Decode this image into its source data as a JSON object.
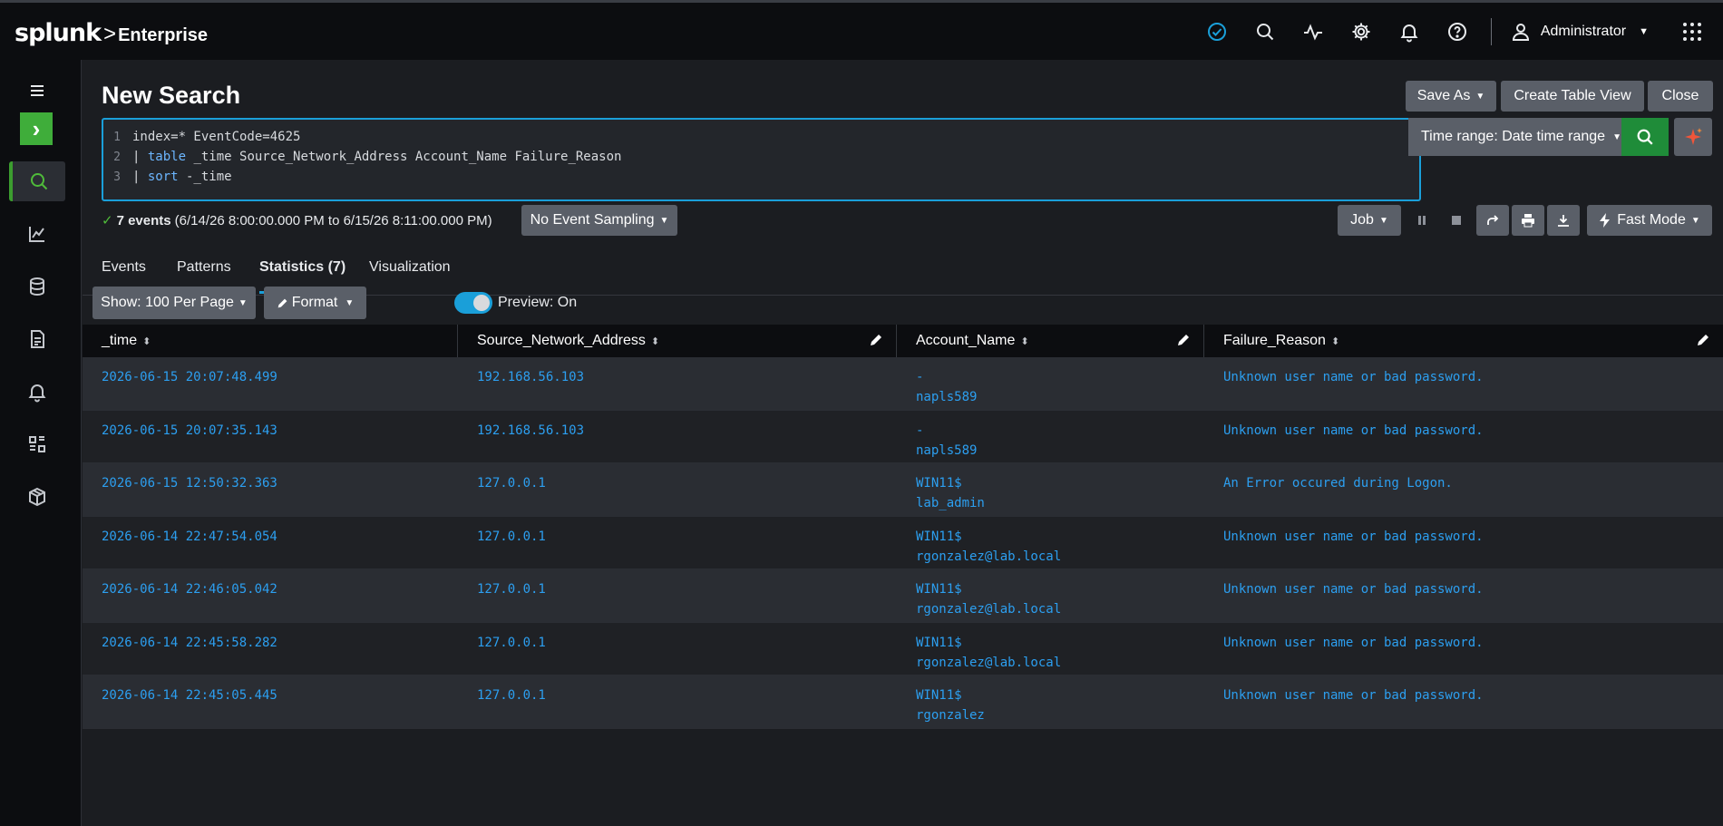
{
  "brand": {
    "logo": "splunk",
    "separator": ">",
    "product": "Enterprise"
  },
  "topbar": {
    "user_name": "Administrator"
  },
  "icons": [
    "status-check-icon",
    "search-icon",
    "activity-icon",
    "gear-icon",
    "bell-icon",
    "help-icon",
    "user-icon",
    "apps-grid-icon",
    "menu-icon",
    "search-nav-icon",
    "chart-icon",
    "database-icon",
    "report-icon",
    "alert-bell-icon",
    "dashboards-icon",
    "datasets-icon",
    "pencil-icon",
    "lightning-icon",
    "sparkle-icon"
  ],
  "page": {
    "title": "New Search"
  },
  "header_buttons": {
    "save_as": "Save As",
    "create_table_view": "Create Table View",
    "close": "Close"
  },
  "search": {
    "lines": [
      {
        "n": "1",
        "text": "index=* EventCode=4625"
      },
      {
        "n": "2",
        "pipe": "| ",
        "cmd": "table",
        "rest": " _time Source_Network_Address Account_Name Failure_Reason"
      },
      {
        "n": "3",
        "pipe": "| ",
        "cmd": "sort",
        "rest": " -_time"
      }
    ],
    "time_range": "Time range: Date time range"
  },
  "status": {
    "count": "7 events",
    "range": "(6/14/26 8:00:00.000 PM to 6/15/26 8:11:00.000 PM)",
    "sampling": "No Event Sampling",
    "job": "Job",
    "mode": "Fast Mode"
  },
  "tabs": [
    {
      "label": "Events"
    },
    {
      "label": "Patterns"
    },
    {
      "label": "Statistics (7)"
    },
    {
      "label": "Visualization"
    }
  ],
  "toolbar": {
    "show": "Show: 100 Per Page",
    "format": "Format",
    "preview": "Preview: On"
  },
  "colors": {
    "accent": "#1a9fd9",
    "go_green": "#1f8c39",
    "link": "#2c9ff0"
  },
  "table": {
    "columns": [
      "_time",
      "Source_Network_Address",
      "Account_Name",
      "Failure_Reason"
    ],
    "rows": [
      {
        "time": "2026-06-15 20:07:48.499",
        "src": "192.168.56.103",
        "acct1": "-",
        "acct2": "napls589",
        "reason": "Unknown user name or bad password."
      },
      {
        "time": "2026-06-15 20:07:35.143",
        "src": "192.168.56.103",
        "acct1": "-",
        "acct2": "napls589",
        "reason": "Unknown user name or bad password."
      },
      {
        "time": "2026-06-15 12:50:32.363",
        "src": "127.0.0.1",
        "acct1": "WIN11$",
        "acct2": "lab_admin",
        "reason": "An Error occured during Logon."
      },
      {
        "time": "2026-06-14 22:47:54.054",
        "src": "127.0.0.1",
        "acct1": "WIN11$",
        "acct2": "rgonzalez@lab.local",
        "reason": "Unknown user name or bad password."
      },
      {
        "time": "2026-06-14 22:46:05.042",
        "src": "127.0.0.1",
        "acct1": "WIN11$",
        "acct2": "rgonzalez@lab.local",
        "reason": "Unknown user name or bad password."
      },
      {
        "time": "2026-06-14 22:45:58.282",
        "src": "127.0.0.1",
        "acct1": "WIN11$",
        "acct2": "rgonzalez@lab.local",
        "reason": "Unknown user name or bad password."
      },
      {
        "time": "2026-06-14 22:45:05.445",
        "src": "127.0.0.1",
        "acct1": "WIN11$",
        "acct2": "rgonzalez",
        "reason": "Unknown user name or bad password."
      }
    ]
  }
}
